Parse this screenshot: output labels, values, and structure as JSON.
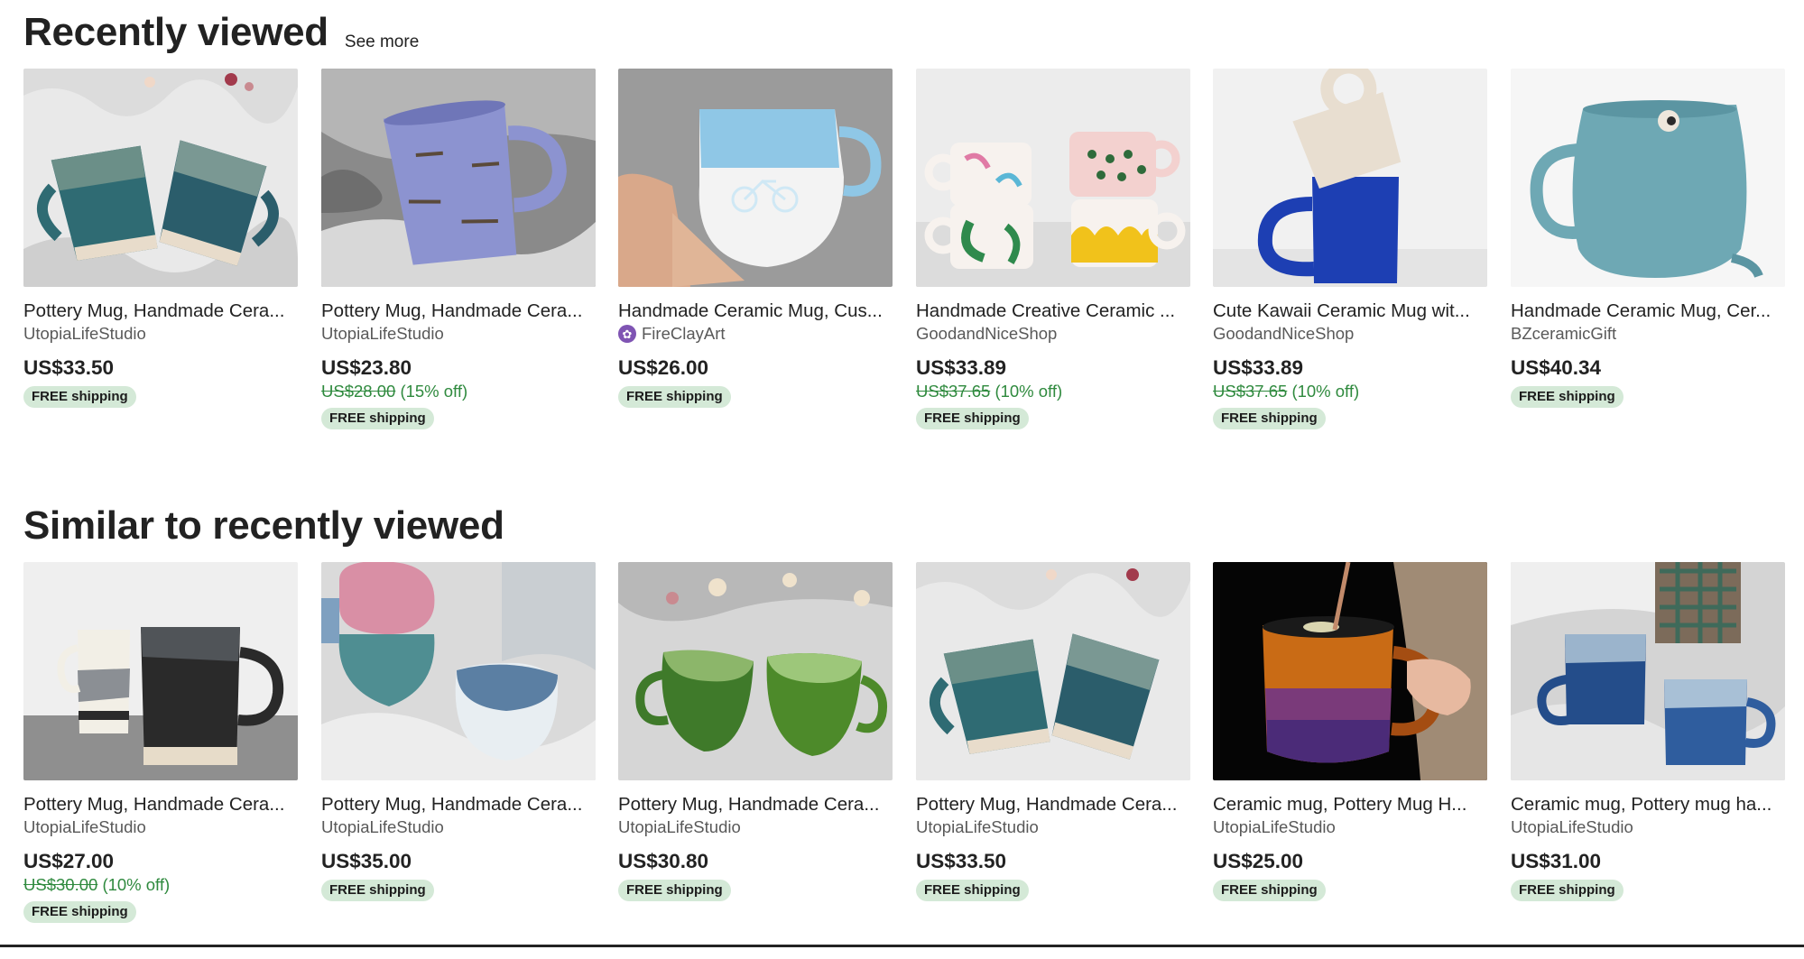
{
  "sections": {
    "recent": {
      "title": "Recently viewed",
      "see_more": "See more",
      "items": [
        {
          "title": "Pottery Mug, Handmade Cera...",
          "shop": "UtopiaLifeStudio",
          "price": "US$33.50",
          "original_price": "",
          "discount": "",
          "shipping": "FREE shipping",
          "image": "two-blue-green-mugs-on-fur"
        },
        {
          "title": "Pottery Mug, Handmade Cera...",
          "shop": "UtopiaLifeStudio",
          "price": "US$23.80",
          "original_price": "US$28.00",
          "discount": "(15% off)",
          "shipping": "FREE shipping",
          "image": "lavender-mug-on-fur"
        },
        {
          "title": "Handmade Ceramic Mug, Cus...",
          "shop": "FireClayArt",
          "shop_badge": "star-seller-icon",
          "price": "US$26.00",
          "original_price": "",
          "discount": "",
          "shipping": "FREE shipping",
          "image": "blue-white-bicycle-mug-in-hand"
        },
        {
          "title": "Handmade Creative Ceramic ...",
          "shop": "GoodandNiceShop",
          "price": "US$33.89",
          "original_price": "US$37.65",
          "discount": "(10% off)",
          "shipping": "FREE shipping",
          "image": "four-patterned-mugs"
        },
        {
          "title": "Cute Kawaii Ceramic Mug wit...",
          "shop": "GoodandNiceShop",
          "price": "US$33.89",
          "original_price": "US$37.65",
          "discount": "(10% off)",
          "shipping": "FREE shipping",
          "image": "stacked-cream-and-blue-mugs"
        },
        {
          "title": "Handmade Ceramic Mug, Cer...",
          "shop": "BZceramicGift",
          "price": "US$40.34",
          "original_price": "",
          "discount": "",
          "shipping": "FREE shipping",
          "image": "teal-mug-with-face"
        }
      ]
    },
    "similar": {
      "title": "Similar to recently viewed",
      "items": [
        {
          "title": "Pottery Mug, Handmade Cera...",
          "shop": "UtopiaLifeStudio",
          "price": "US$27.00",
          "original_price": "US$30.00",
          "discount": "(10% off)",
          "shipping": "FREE shipping",
          "image": "grey-and-black-mugs"
        },
        {
          "title": "Pottery Mug, Handmade Cera...",
          "shop": "UtopiaLifeStudio",
          "price": "US$35.00",
          "original_price": "",
          "discount": "",
          "shipping": "FREE shipping",
          "image": "pink-teal-white-mugs-on-fur"
        },
        {
          "title": "Pottery Mug, Handmade Cera...",
          "shop": "UtopiaLifeStudio",
          "price": "US$30.80",
          "original_price": "",
          "discount": "",
          "shipping": "FREE shipping",
          "image": "two-green-mugs-on-fur"
        },
        {
          "title": "Pottery Mug, Handmade Cera...",
          "shop": "UtopiaLifeStudio",
          "price": "US$33.50",
          "original_price": "",
          "discount": "",
          "shipping": "FREE shipping",
          "image": "two-blue-green-mugs-on-fur"
        },
        {
          "title": "Ceramic mug, Pottery Mug H...",
          "shop": "UtopiaLifeStudio",
          "price": "US$25.00",
          "original_price": "",
          "discount": "",
          "shipping": "FREE shipping",
          "image": "amber-purple-mug-in-hand"
        },
        {
          "title": "Ceramic mug, Pottery mug ha...",
          "shop": "UtopiaLifeStudio",
          "price": "US$31.00",
          "original_price": "",
          "discount": "",
          "shipping": "FREE shipping",
          "image": "two-blue-mugs-on-fur"
        }
      ]
    }
  },
  "colors": {
    "discount_green": "#2f8a3e",
    "shipping_badge_bg": "#d4e9d7",
    "star_seller_purple": "#7f54b3"
  }
}
